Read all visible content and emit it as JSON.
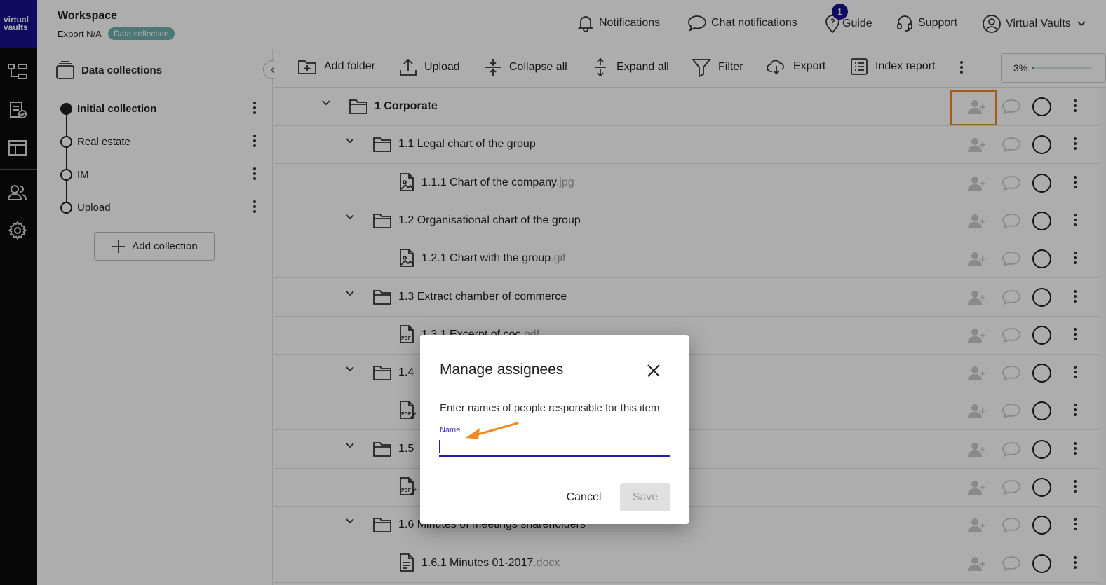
{
  "brand": {
    "logo_line1": "virtual",
    "logo_line2": "vaults"
  },
  "header": {
    "workspace_title": "Workspace",
    "workspace_sub": "Export N/A",
    "badge": "Data collection",
    "nav": {
      "notifications": "Notifications",
      "chat_notifications": "Chat notifications",
      "guide": "Guide",
      "guide_badge": "1",
      "support": "Support",
      "account": "Virtual Vaults"
    }
  },
  "sidebar": {
    "title": "Data collections",
    "collections": [
      {
        "label": "Initial collection",
        "active": true
      },
      {
        "label": "Real estate",
        "active": false
      },
      {
        "label": "IM",
        "active": false
      },
      {
        "label": "Upload",
        "active": false
      }
    ],
    "add_collection": "Add collection"
  },
  "toolbar": {
    "add_folder": "Add folder",
    "upload": "Upload",
    "collapse_all": "Collapse all",
    "expand_all": "Expand all",
    "filter": "Filter",
    "export": "Export",
    "index_report": "Index report",
    "progress_text": "3%",
    "progress_value": 0.03
  },
  "tree": [
    {
      "num": "1",
      "title": "Corporate",
      "ext": "",
      "kind": "folder",
      "level": 0
    },
    {
      "num": "1.1",
      "title": "Legal chart of the group",
      "ext": "",
      "kind": "folder",
      "level": 1
    },
    {
      "num": "1.1.1",
      "title": "Chart of the company",
      "ext": ".jpg",
      "kind": "image",
      "level": 2
    },
    {
      "num": "1.2",
      "title": "Organisational chart of the group",
      "ext": "",
      "kind": "folder",
      "level": 1
    },
    {
      "num": "1.2.1",
      "title": "Chart with the group",
      "ext": ".gif",
      "kind": "image",
      "level": 2
    },
    {
      "num": "1.3",
      "title": "Extract chamber of commerce",
      "ext": "",
      "kind": "folder",
      "level": 1
    },
    {
      "num": "1.3.1",
      "title": "Excerpt of coc",
      "ext": ".pdf",
      "kind": "pdf",
      "level": 2
    },
    {
      "num": "1.4",
      "title": "",
      "ext": "",
      "kind": "folder",
      "level": 1
    },
    {
      "num": "",
      "title": "",
      "ext": "",
      "kind": "pdfedit",
      "level": 2
    },
    {
      "num": "1.5",
      "title": "",
      "ext": "",
      "kind": "folder",
      "level": 1
    },
    {
      "num": "",
      "title": "",
      "ext": "",
      "kind": "pdfedit",
      "level": 2
    },
    {
      "num": "1.6",
      "title": "Minutes of meetings shareholders",
      "ext": "",
      "kind": "folder",
      "level": 1
    },
    {
      "num": "1.6.1",
      "title": "Minutes 01-2017",
      "ext": ".docx",
      "kind": "doc",
      "level": 2
    }
  ],
  "dialog": {
    "title": "Manage assignees",
    "description": "Enter names of people responsible for this item",
    "name_label": "Name",
    "name_value": "",
    "cancel": "Cancel",
    "save": "Save"
  },
  "colors": {
    "brand": "#1a0f8f",
    "accent": "#f08a24",
    "badge": "#6fb1ac",
    "input_focus": "#2b1fb0"
  }
}
